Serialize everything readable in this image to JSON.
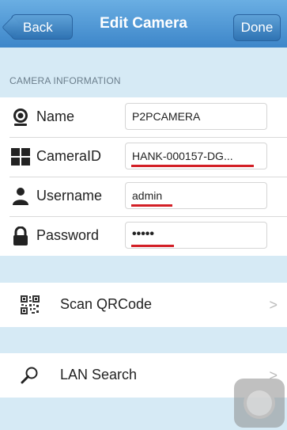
{
  "navbar": {
    "title": "Edit Camera",
    "back_label": "Back",
    "done_label": "Done"
  },
  "section": {
    "header": "CAMERA INFORMATION"
  },
  "fields": [
    {
      "label": "Name",
      "value": "P2PCAMERA",
      "icon": "webcam-icon"
    },
    {
      "label": "CameraID",
      "value": "HANK-000157-DG...",
      "icon": "grid-icon"
    },
    {
      "label": "Username",
      "value": "admin",
      "icon": "user-icon"
    },
    {
      "label": "Password",
      "value": "•••••",
      "icon": "lock-icon"
    }
  ],
  "actions": [
    {
      "label": "Scan QRCode",
      "icon": "qr-code-icon",
      "chevron": ">"
    },
    {
      "label": "LAN Search",
      "icon": "magnifier-icon",
      "chevron": ">"
    }
  ],
  "colors": {
    "accent": "#3d86c9",
    "background": "#d6eaf5",
    "highlight": "#d31f26"
  }
}
